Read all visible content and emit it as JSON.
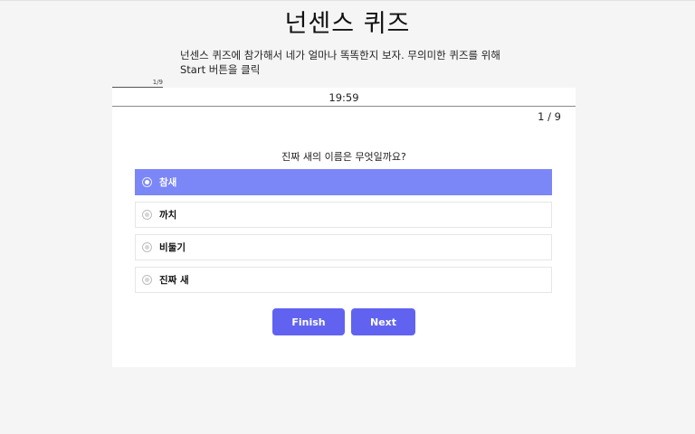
{
  "header": {
    "title": "넌센스 퀴즈",
    "description": "넌센스 퀴즈에 참가해서 네가 얼마나 똑똑한지 보자. 무의미한 퀴즈를 위해 Start 버튼을 클릭"
  },
  "progress": {
    "label": "1/9",
    "current": 1,
    "total": 9
  },
  "quiz": {
    "timer": "19:59",
    "counter": "1 / 9",
    "question": "진짜 새의 이름은 무엇일까요?",
    "options": [
      {
        "label": "참새",
        "selected": true
      },
      {
        "label": "까치",
        "selected": false
      },
      {
        "label": "비둘기",
        "selected": false
      },
      {
        "label": "진짜 새",
        "selected": false
      }
    ]
  },
  "buttons": {
    "finish_label": "Finish",
    "next_label": "Next"
  },
  "colors": {
    "accent": "#6163f0",
    "selected_option": "#7b86f7",
    "background": "#f5f5f5"
  }
}
